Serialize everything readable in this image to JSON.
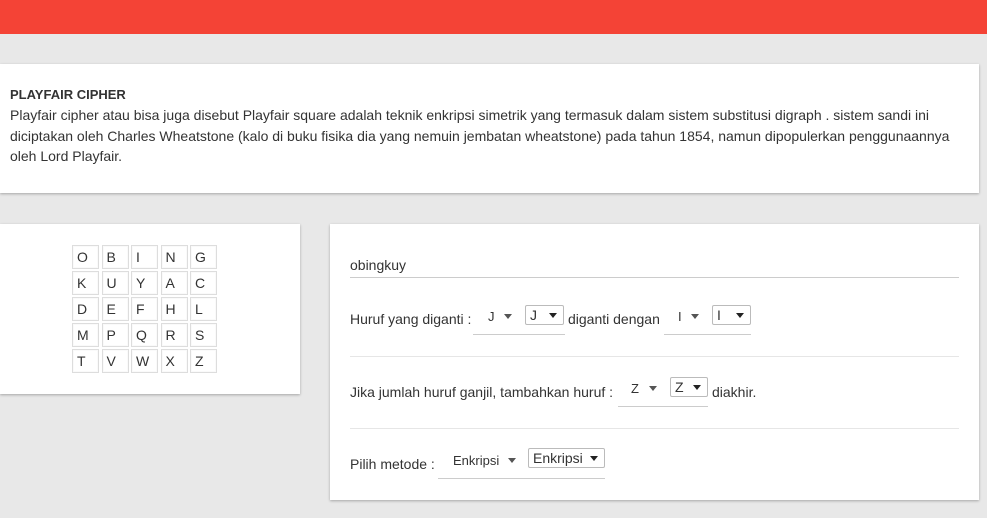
{
  "info": {
    "title": "PLAYFAIR CIPHER",
    "description": "Playfair cipher atau bisa juga disebut Playfair square adalah teknik enkripsi simetrik yang termasuk dalam sistem substitusi digraph . sistem sandi ini diciptakan oleh Charles Wheatstone (kalo di buku fisika dia yang nemuin jembatan wheatstone) pada tahun 1854, namun dipopulerkan penggunaannya oleh Lord Playfair."
  },
  "grid": {
    "rows": [
      [
        "O",
        "B",
        "I",
        "N",
        "G"
      ],
      [
        "K",
        "U",
        "Y",
        "A",
        "C"
      ],
      [
        "D",
        "E",
        "F",
        "H",
        "L"
      ],
      [
        "M",
        "P",
        "Q",
        "R",
        "S"
      ],
      [
        "T",
        "V",
        "W",
        "X",
        "Z"
      ]
    ]
  },
  "form": {
    "key_value": "obingkuy",
    "replace": {
      "label": "Huruf yang diganti :",
      "select_value": "J",
      "native_value": "J",
      "middle_label": "diganti dengan",
      "with_select_value": "I",
      "with_native_value": "I"
    },
    "odd": {
      "label": "Jika jumlah huruf ganjil, tambahkan huruf :",
      "select_value": "Z",
      "native_value": "Z",
      "suffix": "diakhir."
    },
    "method": {
      "label": "Pilih metode :",
      "select_value": "Enkripsi",
      "native_value": "Enkripsi"
    }
  },
  "colors": {
    "topbar": "#f44336",
    "background": "#e8e8e8",
    "card": "#ffffff"
  }
}
